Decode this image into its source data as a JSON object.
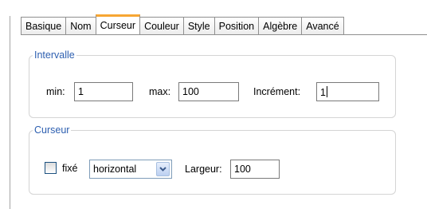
{
  "tabs": [
    {
      "label": "Basique",
      "active": false
    },
    {
      "label": "Nom",
      "active": false
    },
    {
      "label": "Curseur",
      "active": true
    },
    {
      "label": "Couleur",
      "active": false
    },
    {
      "label": "Style",
      "active": false
    },
    {
      "label": "Position",
      "active": false
    },
    {
      "label": "Algèbre",
      "active": false
    },
    {
      "label": "Avancé",
      "active": false
    }
  ],
  "intervalle": {
    "legend": "Intervalle",
    "min_label": "min:",
    "min_value": "1",
    "max_label": "max:",
    "max_value": "100",
    "increment_label": "Incrément:",
    "increment_value": "1"
  },
  "curseur": {
    "legend": "Curseur",
    "fixed_label": "fixé",
    "fixed_checked": false,
    "orientation_value": "horizontal",
    "width_label": "Largeur:",
    "width_value": "100"
  },
  "colors": {
    "active_tab_accent": "#f7a633",
    "legend_text": "#2d5fb0"
  }
}
